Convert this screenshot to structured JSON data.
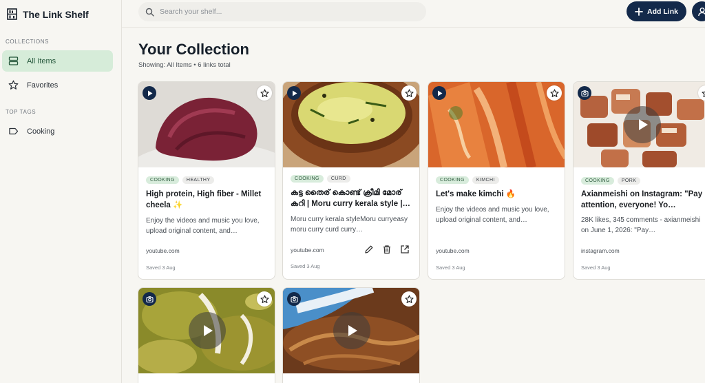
{
  "app": {
    "title": "The Link Shelf"
  },
  "sidebar": {
    "collections_label": "COLLECTIONS",
    "items": [
      {
        "label": "All Items",
        "icon": "list-icon",
        "active": true
      },
      {
        "label": "Favorites",
        "icon": "star-icon",
        "active": false
      }
    ],
    "tags_label": "TOP TAGS",
    "tags": [
      {
        "label": "Cooking",
        "icon": "tag-icon"
      }
    ]
  },
  "search": {
    "placeholder": "Search your shelf..."
  },
  "header": {
    "add_label": "Add Link"
  },
  "main": {
    "title": "Your Collection",
    "subtitle": "Showing: All Items • 6 links total"
  },
  "cards": [
    {
      "type": "video",
      "tags": [
        "COOKING",
        "HEALTHY"
      ],
      "title": "High protein, High fiber - Millet cheela ✨",
      "description": "Enjoy the videos and music you love, upload original content, and…",
      "domain": "youtube.com",
      "saved": "Saved 3 Aug"
    },
    {
      "type": "video",
      "tags": [
        "COOKING",
        "CURD"
      ],
      "title": "കട്ട തൈര് കൊണ്ട് ക്രീമി മോര് കറി | Moru curry kerala style |…",
      "description": "Moru curry kerala styleMoru curryeasy moru curry curd curry…",
      "domain": "youtube.com",
      "saved": "Saved 3 Aug"
    },
    {
      "type": "video",
      "tags": [
        "COOKING",
        "KIMCHI"
      ],
      "title": "Let's make kimchi 🔥",
      "description": "Enjoy the videos and music you love, upload original content, and…",
      "domain": "youtube.com",
      "saved": "Saved 3 Aug"
    },
    {
      "type": "instagram",
      "tags": [
        "COOKING",
        "PORK"
      ],
      "title": "Axianmeishi on Instagram: \"Pay attention, everyone! Yo…",
      "description": "28K likes, 345 comments - axianmeishi on June 1, 2026: \"Pay…",
      "domain": "instagram.com",
      "saved": "Saved 3 Aug"
    },
    {
      "type": "instagram"
    },
    {
      "type": "instagram"
    }
  ],
  "colors": {
    "accent": "#13294a",
    "active_bg": "#d6ecd9",
    "tag_green": "#d8ecdc"
  }
}
